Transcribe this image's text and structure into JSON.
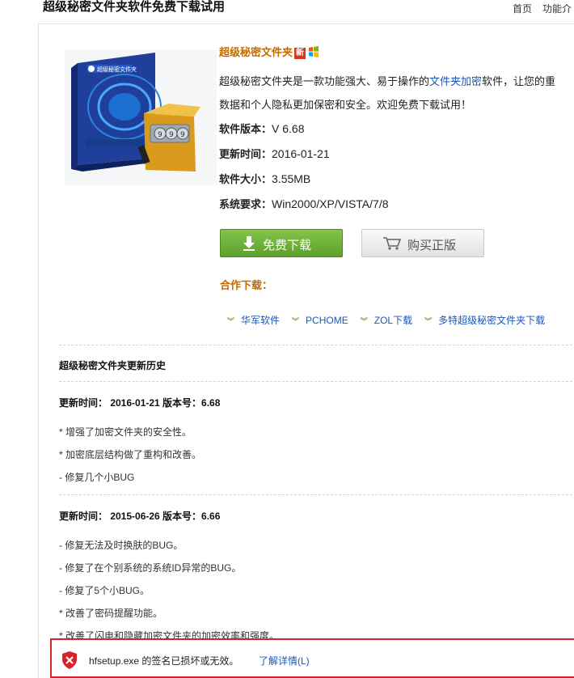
{
  "header": {
    "title": "超级秘密文件夹软件免费下载试用",
    "nav": [
      "首页",
      "功能介"
    ]
  },
  "product": {
    "name": "超级秘密文件夹",
    "badge": "新",
    "desc_prefix": "超级秘密文件夹是一款功能强大、易于操作的",
    "desc_link": "文件夹加密",
    "desc_suffix": "软件，让您的重",
    "desc_line2": "数据和个人隐私更加保密和安全。欢迎免费下载试用！",
    "specs": [
      {
        "label": "软件版本：",
        "value": "V 6.68"
      },
      {
        "label": "更新时间：",
        "value": "2016-01-21"
      },
      {
        "label": "软件大小：",
        "value": "3.55MB"
      },
      {
        "label": "系统要求：",
        "value": "Win2000/XP/VISTA/7/8"
      }
    ],
    "box_text": "超级秘密文件夹"
  },
  "buttons": {
    "free_download": "免费下载",
    "buy": "购买正版"
  },
  "partners": {
    "title": "合作下载：",
    "links": [
      "华军软件",
      "PCHOME",
      "ZOL下载",
      "多特超级秘密文件夹下载"
    ]
  },
  "history": {
    "title": "超级秘密文件夹更新历史",
    "versions": [
      {
        "header": "更新时间： 2016-01-21 版本号：6.68",
        "changes": [
          "* 增强了加密文件夹的安全性。",
          "* 加密底层结构做了重构和改善。",
          "- 修复几个小BUG"
        ]
      },
      {
        "header": "更新时间： 2015-06-26 版本号：6.66",
        "changes": [
          "- 修复无法及时换肤的BUG。",
          "- 修复了在个别系统的系统ID异常的BUG。",
          "- 修复了5个小BUG。",
          "* 改善了密码提醒功能。",
          "* 改善了闪电和隐藏加密文件夹的加密效率和强度。"
        ]
      }
    ]
  },
  "warning": {
    "text": "hfsetup.exe 的签名已损坏或无效。",
    "link": "了解详情(L)"
  }
}
